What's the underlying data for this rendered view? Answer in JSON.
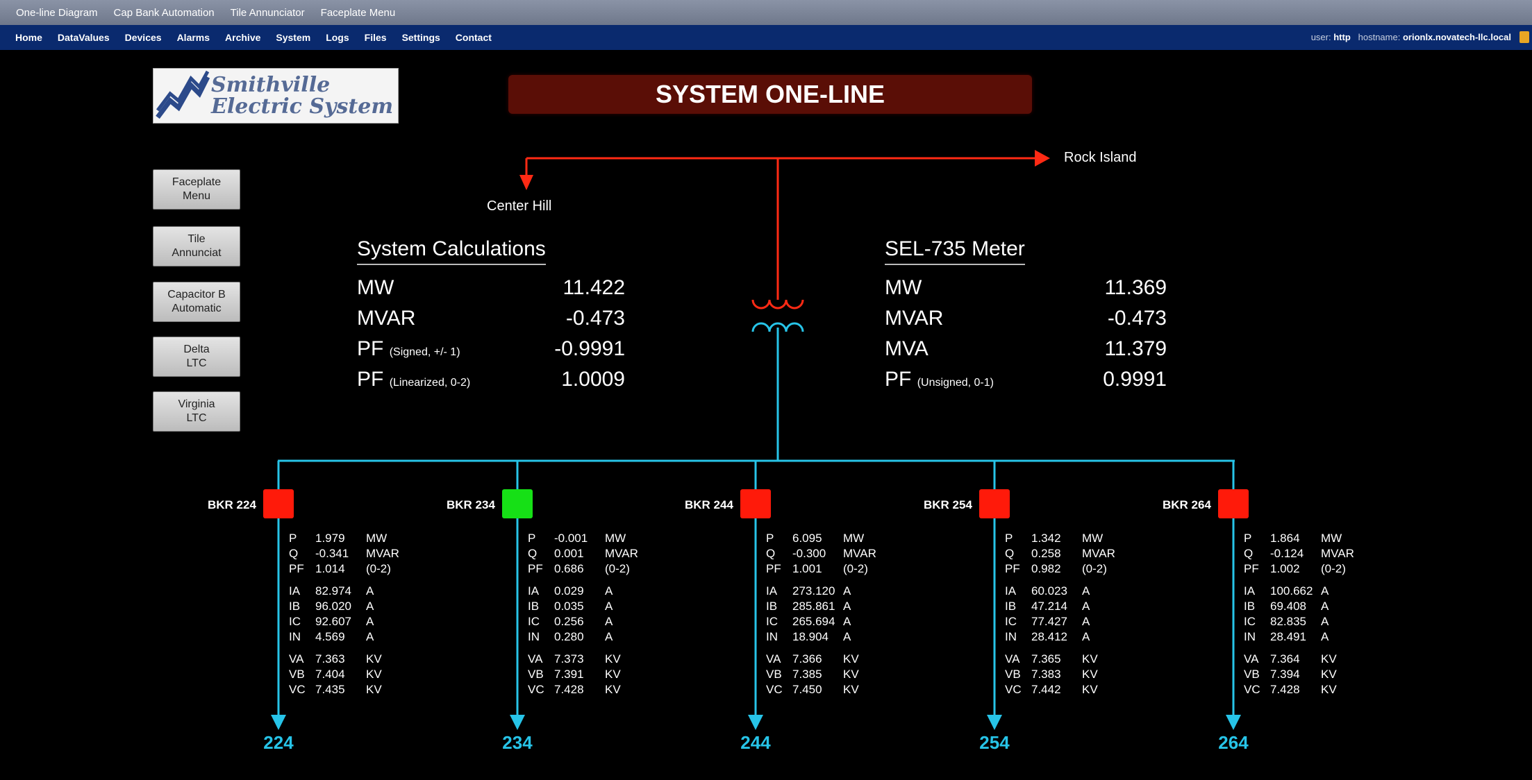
{
  "menubar": [
    "One-line Diagram",
    "Cap Bank Automation",
    "Tile Annunciator",
    "Faceplate Menu"
  ],
  "navbar": [
    "Home",
    "DataValues",
    "Devices",
    "Alarms",
    "Archive",
    "System",
    "Logs",
    "Files",
    "Settings",
    "Contact"
  ],
  "user_info": {
    "user_label": "user:",
    "user": "http",
    "host_label": "hostname:",
    "hostname": "orionlx.novatech-llc.local"
  },
  "logo_text": "Smithville\nElectric System",
  "page_title": "SYSTEM ONE-LINE",
  "side_buttons": [
    "Faceplate\nMenu",
    "Tile\nAnnunciat",
    "Capacitor B\nAutomatic",
    "Delta\nLTC",
    "Virginia\nLTC"
  ],
  "lines": {
    "left_feed": "Center Hill",
    "right_feed": "Rock Island"
  },
  "system_calc": {
    "title": "System Calculations",
    "rows": [
      {
        "key": "MW",
        "sub": "",
        "value": "11.422"
      },
      {
        "key": "MVAR",
        "sub": "",
        "value": "-0.473"
      },
      {
        "key": "PF",
        "sub": "(Signed, +/- 1)",
        "value": "-0.9991"
      },
      {
        "key": "PF",
        "sub": "(Linearized, 0-2)",
        "value": "1.0009"
      }
    ]
  },
  "meter": {
    "title": "SEL-735 Meter",
    "rows": [
      {
        "key": "MW",
        "sub": "",
        "value": "11.369"
      },
      {
        "key": "MVAR",
        "sub": "",
        "value": "-0.473"
      },
      {
        "key": "MVA",
        "sub": "",
        "value": "11.379"
      },
      {
        "key": "PF",
        "sub": "(Unsigned, 0-1)",
        "value": "0.9991"
      }
    ]
  },
  "colors": {
    "breaker_open": "#ff1a0a",
    "breaker_closed": "#16e016",
    "bus": "#27c4e8",
    "source_line": "#ff2a14"
  },
  "feeders": [
    {
      "breaker": "BKR 224",
      "status": "open",
      "number": "224",
      "pq": [
        [
          "P",
          "1.979",
          "MW"
        ],
        [
          "Q",
          "-0.341",
          "MVAR"
        ],
        [
          "PF",
          "1.014",
          "(0-2)"
        ]
      ],
      "amps": [
        [
          "IA",
          "82.974",
          "A"
        ],
        [
          "IB",
          "96.020",
          "A"
        ],
        [
          "IC",
          "92.607",
          "A"
        ],
        [
          "IN",
          "4.569",
          "A"
        ]
      ],
      "volts": [
        [
          "VA",
          "7.363",
          "KV"
        ],
        [
          "VB",
          "7.404",
          "KV"
        ],
        [
          "VC",
          "7.435",
          "KV"
        ]
      ]
    },
    {
      "breaker": "BKR 234",
      "status": "closed",
      "number": "234",
      "pq": [
        [
          "P",
          "-0.001",
          "MW"
        ],
        [
          "Q",
          "0.001",
          "MVAR"
        ],
        [
          "PF",
          "0.686",
          "(0-2)"
        ]
      ],
      "amps": [
        [
          "IA",
          "0.029",
          "A"
        ],
        [
          "IB",
          "0.035",
          "A"
        ],
        [
          "IC",
          "0.256",
          "A"
        ],
        [
          "IN",
          "0.280",
          "A"
        ]
      ],
      "volts": [
        [
          "VA",
          "7.373",
          "KV"
        ],
        [
          "VB",
          "7.391",
          "KV"
        ],
        [
          "VC",
          "7.428",
          "KV"
        ]
      ]
    },
    {
      "breaker": "BKR 244",
      "status": "open",
      "number": "244",
      "pq": [
        [
          "P",
          "6.095",
          "MW"
        ],
        [
          "Q",
          "-0.300",
          "MVAR"
        ],
        [
          "PF",
          "1.001",
          "(0-2)"
        ]
      ],
      "amps": [
        [
          "IA",
          "273.120",
          "A"
        ],
        [
          "IB",
          "285.861",
          "A"
        ],
        [
          "IC",
          "265.694",
          "A"
        ],
        [
          "IN",
          "18.904",
          "A"
        ]
      ],
      "volts": [
        [
          "VA",
          "7.366",
          "KV"
        ],
        [
          "VB",
          "7.385",
          "KV"
        ],
        [
          "VC",
          "7.450",
          "KV"
        ]
      ]
    },
    {
      "breaker": "BKR 254",
      "status": "open",
      "number": "254",
      "pq": [
        [
          "P",
          "1.342",
          "MW"
        ],
        [
          "Q",
          "0.258",
          "MVAR"
        ],
        [
          "PF",
          "0.982",
          "(0-2)"
        ]
      ],
      "amps": [
        [
          "IA",
          "60.023",
          "A"
        ],
        [
          "IB",
          "47.214",
          "A"
        ],
        [
          "IC",
          "77.427",
          "A"
        ],
        [
          "IN",
          "28.412",
          "A"
        ]
      ],
      "volts": [
        [
          "VA",
          "7.365",
          "KV"
        ],
        [
          "VB",
          "7.383",
          "KV"
        ],
        [
          "VC",
          "7.442",
          "KV"
        ]
      ]
    },
    {
      "breaker": "BKR 264",
      "status": "open",
      "number": "264",
      "pq": [
        [
          "P",
          "1.864",
          "MW"
        ],
        [
          "Q",
          "-0.124",
          "MVAR"
        ],
        [
          "PF",
          "1.002",
          "(0-2)"
        ]
      ],
      "amps": [
        [
          "IA",
          "100.662",
          "A"
        ],
        [
          "IB",
          "69.408",
          "A"
        ],
        [
          "IC",
          "82.835",
          "A"
        ],
        [
          "IN",
          "28.491",
          "A"
        ]
      ],
      "volts": [
        [
          "VA",
          "7.364",
          "KV"
        ],
        [
          "VB",
          "7.394",
          "KV"
        ],
        [
          "VC",
          "7.428",
          "KV"
        ]
      ]
    }
  ]
}
